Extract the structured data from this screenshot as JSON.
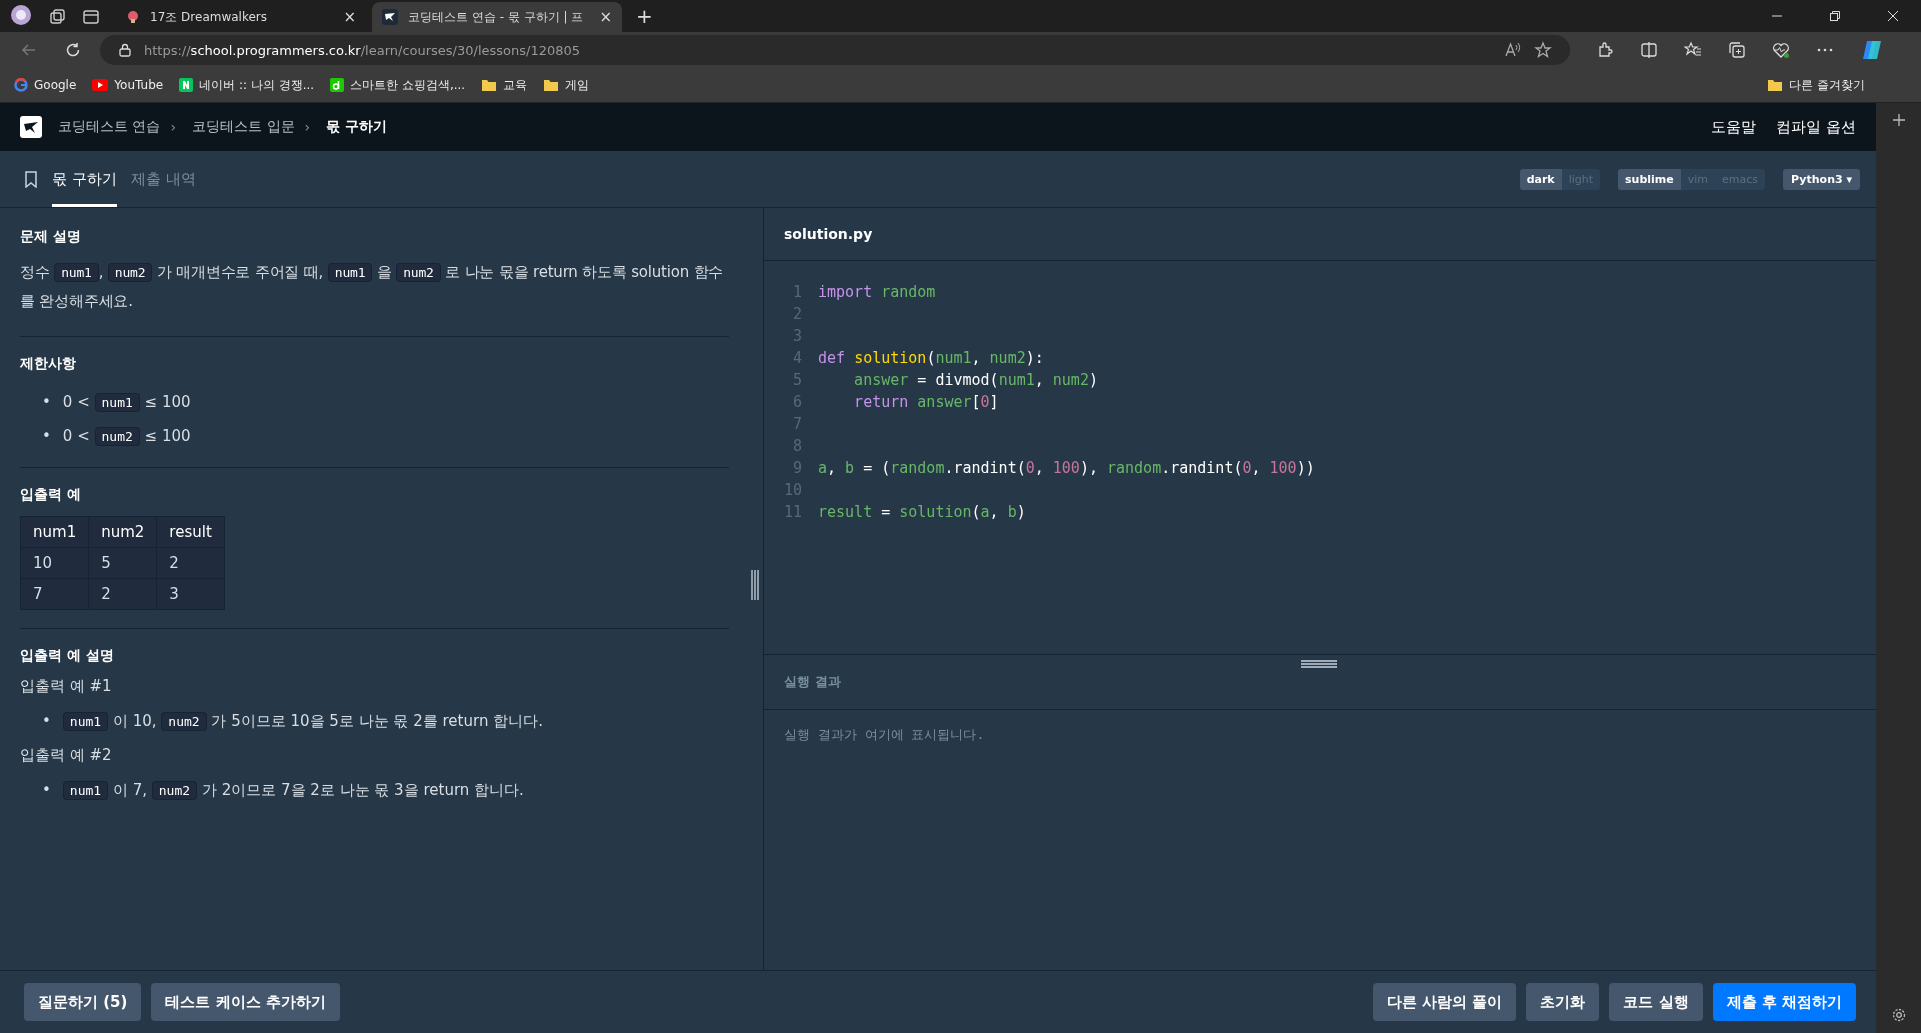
{
  "browser": {
    "tabs": [
      {
        "title": "17조 Dreamwalkers",
        "selected": false,
        "close": "×"
      },
      {
        "title": "코딩테스트 연습 - 몫 구하기 | 프",
        "selected": true,
        "close": "×"
      }
    ],
    "new_tab": "+",
    "url": [
      {
        "text": "https://",
        "kind": "dim"
      },
      {
        "text": "school.programmers.co.kr",
        "kind": "host"
      },
      {
        "text": "/learn/courses/30/lessons/120805",
        "kind": "dim"
      }
    ],
    "bookmarks": [
      {
        "label": "Google",
        "kind": "google"
      },
      {
        "label": "YouTube",
        "kind": "youtube"
      },
      {
        "label": "네이버 :: 나의 경쟁...",
        "kind": "naver"
      },
      {
        "label": "스마트한 쇼핑검색,...",
        "kind": "d"
      },
      {
        "label": "교육",
        "kind": "folder"
      },
      {
        "label": "게임",
        "kind": "folder"
      }
    ],
    "other_favorites": "다른 즐겨찾기"
  },
  "header": {
    "breadcrumb": [
      {
        "label": "코딩테스트 연습",
        "current": false
      },
      {
        "label": "코딩테스트 입문",
        "current": false
      },
      {
        "label": "몫 구하기",
        "current": true
      }
    ],
    "separator": "›",
    "links": [
      "도움말",
      "컴파일 옵션"
    ]
  },
  "problem_tabs": [
    {
      "label": "몫 구하기",
      "selected": true
    },
    {
      "label": "제출 내역",
      "selected": false
    }
  ],
  "editor_options": {
    "themes": [
      {
        "label": "dark",
        "selected": true
      },
      {
        "label": "light",
        "selected": false
      }
    ],
    "keymaps": [
      {
        "label": "sublime",
        "selected": true
      },
      {
        "label": "vim",
        "selected": false
      },
      {
        "label": "emacs",
        "selected": false
      }
    ],
    "language": "Python3",
    "language_caret": "▾"
  },
  "bullet": "•",
  "description": {
    "title": "문제 설명",
    "paragraph": [
      {
        "kind": "text",
        "text": "정수 "
      },
      {
        "kind": "code",
        "text": "num1"
      },
      {
        "kind": "text",
        "text": ", "
      },
      {
        "kind": "code",
        "text": "num2"
      },
      {
        "kind": "text",
        "text": " 가 매개변수로 주어질 때, "
      },
      {
        "kind": "code",
        "text": "num1"
      },
      {
        "kind": "text",
        "text": " 을 "
      },
      {
        "kind": "code",
        "text": "num2"
      },
      {
        "kind": "text",
        "text": " 로 나눈 몫을 return 하도록 solution 함수를 완성해주세요."
      }
    ]
  },
  "constraints": {
    "title": "제한사항",
    "items": [
      [
        {
          "kind": "text",
          "text": "0 < "
        },
        {
          "kind": "code",
          "text": "num1"
        },
        {
          "kind": "text",
          "text": " ≤ 100"
        }
      ],
      [
        {
          "kind": "text",
          "text": "0 < "
        },
        {
          "kind": "code",
          "text": "num2"
        },
        {
          "kind": "text",
          "text": " ≤ 100"
        }
      ]
    ]
  },
  "examples": {
    "title": "입출력 예",
    "columns": [
      "num1",
      "num2",
      "result"
    ],
    "rows": [
      [
        "10",
        "5",
        "2"
      ],
      [
        "7",
        "2",
        "3"
      ]
    ]
  },
  "explanation": {
    "title": "입출력 예 설명",
    "cases": [
      {
        "title": "입출력 예 #1",
        "bullet": [
          {
            "kind": "code",
            "text": "num1"
          },
          {
            "kind": "text",
            "text": " 이 10, "
          },
          {
            "kind": "code",
            "text": "num2"
          },
          {
            "kind": "text",
            "text": " 가 5이므로 10을 5로 나눈 몫 2를 return 합니다."
          }
        ]
      },
      {
        "title": "입출력 예 #2",
        "bullet": [
          {
            "kind": "code",
            "text": "num1"
          },
          {
            "kind": "text",
            "text": " 이 7, "
          },
          {
            "kind": "code",
            "text": "num2"
          },
          {
            "kind": "text",
            "text": " 가 2이므로 7을 2로 나눈 몫 3을 return 합니다."
          }
        ]
      }
    ]
  },
  "editor": {
    "filename": "solution.py",
    "lines": [
      {
        "number": "1",
        "tokens": [
          {
            "text": "import ",
            "kind": "keyword"
          },
          {
            "text": "random",
            "kind": "name"
          }
        ]
      },
      {
        "number": "2"
      },
      {
        "number": "3"
      },
      {
        "number": "4",
        "tokens": [
          {
            "text": "def ",
            "kind": "keyword"
          },
          {
            "text": "solution",
            "kind": "function"
          },
          {
            "text": "(",
            "kind": "plain"
          },
          {
            "text": "num1",
            "kind": "name"
          },
          {
            "text": ", ",
            "kind": "plain"
          },
          {
            "text": "num2",
            "kind": "name"
          },
          {
            "text": "):",
            "kind": "plain"
          }
        ]
      },
      {
        "number": "5",
        "tokens": [
          {
            "text": "    answer",
            "kind": "name"
          },
          {
            "text": " = divmod(",
            "kind": "plain"
          },
          {
            "text": "num1",
            "kind": "name"
          },
          {
            "text": ", ",
            "kind": "plain"
          },
          {
            "text": "num2",
            "kind": "name"
          },
          {
            "text": ")",
            "kind": "plain"
          }
        ]
      },
      {
        "number": "6",
        "tokens": [
          {
            "text": "    return ",
            "kind": "keyword"
          },
          {
            "text": "answer",
            "kind": "name"
          },
          {
            "text": "[",
            "kind": "plain"
          },
          {
            "text": "0",
            "kind": "number"
          },
          {
            "text": "]",
            "kind": "plain"
          }
        ]
      },
      {
        "number": "7"
      },
      {
        "number": "8"
      },
      {
        "number": "9",
        "tokens": [
          {
            "text": "a",
            "kind": "name"
          },
          {
            "text": ", ",
            "kind": "plain"
          },
          {
            "text": "b",
            "kind": "name"
          },
          {
            "text": " = (",
            "kind": "plain"
          },
          {
            "text": "random",
            "kind": "name"
          },
          {
            "text": ".randint(",
            "kind": "plain"
          },
          {
            "text": "0",
            "kind": "number"
          },
          {
            "text": ", ",
            "kind": "plain"
          },
          {
            "text": "100",
            "kind": "number"
          },
          {
            "text": "), ",
            "kind": "plain"
          },
          {
            "text": "random",
            "kind": "name"
          },
          {
            "text": ".randint(",
            "kind": "plain"
          },
          {
            "text": "0",
            "kind": "number"
          },
          {
            "text": ", ",
            "kind": "plain"
          },
          {
            "text": "100",
            "kind": "number"
          },
          {
            "text": "))",
            "kind": "plain"
          }
        ]
      },
      {
        "number": "10"
      },
      {
        "number": "11",
        "tokens": [
          {
            "text": "result",
            "kind": "name"
          },
          {
            "text": " = ",
            "kind": "plain"
          },
          {
            "text": "solution",
            "kind": "name"
          },
          {
            "text": "(",
            "kind": "plain"
          },
          {
            "text": "a",
            "kind": "name"
          },
          {
            "text": ", ",
            "kind": "plain"
          },
          {
            "text": "b",
            "kind": "name"
          },
          {
            "text": ")",
            "kind": "plain"
          }
        ]
      }
    ]
  },
  "result": {
    "title": "실행 결과",
    "placeholder": "실행 결과가 여기에 표시됩니다."
  },
  "footer": {
    "left": [
      {
        "label": "질문하기 (5)",
        "kind": "secondary"
      },
      {
        "label": "테스트 케이스 추가하기",
        "kind": "secondary"
      }
    ],
    "right": [
      {
        "label": "다른 사람의 풀이",
        "kind": "secondary"
      },
      {
        "label": "초기화",
        "kind": "secondary"
      },
      {
        "label": "코드 실행",
        "kind": "secondary"
      },
      {
        "label": "제출 후 채점하기",
        "kind": "primary"
      }
    ]
  }
}
